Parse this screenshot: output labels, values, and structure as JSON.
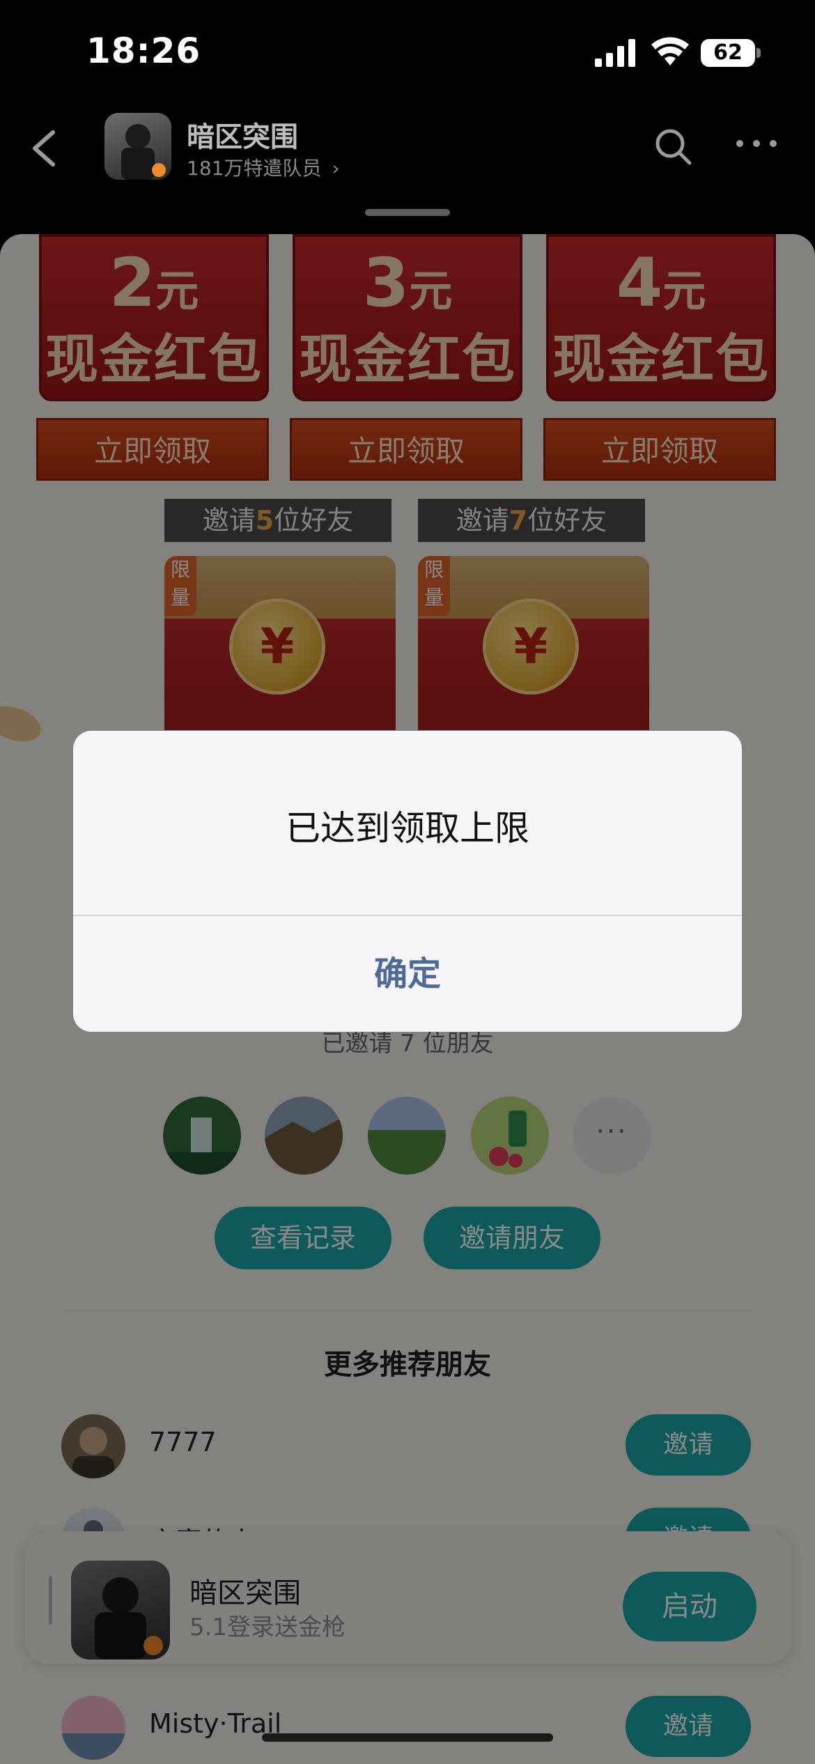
{
  "status_bar": {
    "time": "18:26",
    "battery": "62"
  },
  "header": {
    "title": "暗区突围",
    "subtitle": "181万特遣队员",
    "subtitle_chevron": "›"
  },
  "rewards": [
    {
      "amount": "2",
      "unit": "元",
      "name": "现金红包",
      "claim_label": "立即领取"
    },
    {
      "amount": "3",
      "unit": "元",
      "name": "现金红包",
      "claim_label": "立即领取"
    },
    {
      "amount": "4",
      "unit": "元",
      "name": "现金红包",
      "claim_label": "立即领取"
    }
  ],
  "invite_tiers": [
    {
      "prefix": "邀请",
      "num": "5",
      "suffix": "位好友",
      "badge": "限量",
      "coin": "¥"
    },
    {
      "prefix": "邀请",
      "num": "7",
      "suffix": "位好友",
      "badge": "限量",
      "coin": "¥"
    }
  ],
  "invited_text": "已邀请 7 位朋友",
  "more_friends_label": "···",
  "buttons": {
    "view_records": "查看记录",
    "invite_friends": "邀请朋友"
  },
  "recommend_title": "更多推荐朋友",
  "recommended": [
    {
      "name": "7777",
      "action": "邀请"
    },
    {
      "name": "实寒的人",
      "action": "邀请"
    },
    {
      "name": "Misty·Trail",
      "action": "邀请"
    }
  ],
  "floating_card": {
    "title": "暗区突围",
    "subtitle": "5.1登录送金枪",
    "action": "启动"
  },
  "alert": {
    "message": "已达到领取上限",
    "confirm": "确定"
  }
}
